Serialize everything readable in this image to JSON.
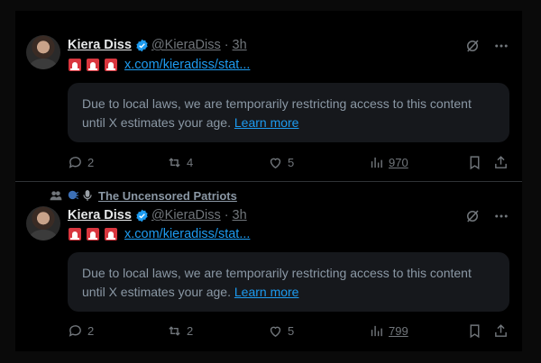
{
  "tweets": [
    {
      "author_name": "Kiera Diss",
      "handle": "@KieraDiss",
      "separator": "·",
      "time": "3h",
      "link_text": "x.com/kieradiss/stat...",
      "notice_text": "Due to local laws, we are temporarily restricting access to this content until X estimates your age.",
      "learn_more": "Learn more",
      "replies": "2",
      "reposts": "4",
      "likes": "5",
      "views": "970"
    },
    {
      "social_context": "The Uncensored Patriots",
      "author_name": "Kiera Diss",
      "handle": "@KieraDiss",
      "separator": "·",
      "time": "3h",
      "link_text": "x.com/kieradiss/stat...",
      "notice_text": "Due to local laws, we are temporarily restricting access to this content until X estimates your age.",
      "learn_more": "Learn more",
      "replies": "2",
      "reposts": "2",
      "likes": "5",
      "views": "799"
    }
  ],
  "colors": {
    "accent": "#1d9bf0",
    "muted": "#71767b",
    "background": "#000000",
    "notice_background": "#16181c"
  },
  "icons": [
    "verified-badge-icon",
    "siren-icon",
    "grok-icon",
    "more-icon",
    "reply-icon",
    "repost-icon",
    "like-icon",
    "views-icon",
    "bookmark-icon",
    "share-icon",
    "people-icon"
  ]
}
